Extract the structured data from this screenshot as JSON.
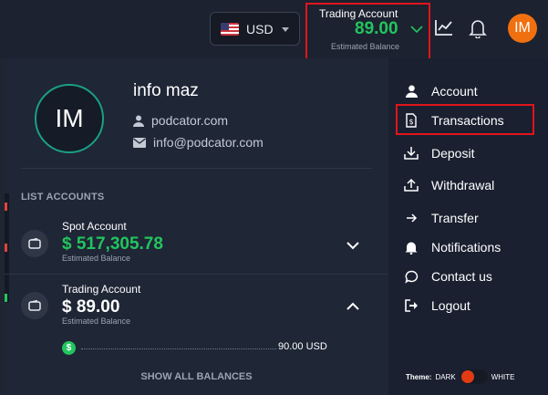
{
  "header": {
    "currency": "USD",
    "account_title": "Trading Account",
    "account_amount": "89.00",
    "account_sub": "Estimated Balance",
    "avatar_initials": "IM"
  },
  "user": {
    "initials": "IM",
    "name": "info maz",
    "username": "podcator.com",
    "email": "info@podcator.com"
  },
  "accounts": {
    "heading": "LIST ACCOUNTS",
    "items": [
      {
        "name": "Spot Account",
        "amount": "$ 517,305.78",
        "sub": "Estimated Balance",
        "expanded": false,
        "amount_color": "#22c55e"
      },
      {
        "name": "Trading Account",
        "amount": "$ 89.00",
        "sub": "Estimated Balance",
        "expanded": true,
        "amount_color": "#ffffff"
      }
    ],
    "balance_symbol": "$",
    "balance_value": "90.00 USD",
    "show_all": "SHOW ALL BALANCES"
  },
  "menu": {
    "items": [
      {
        "label": "Account",
        "icon": "user-icon"
      },
      {
        "label": "Transactions",
        "icon": "receipt-icon"
      },
      {
        "label": "Deposit",
        "icon": "download-icon"
      },
      {
        "label": "Withdrawal",
        "icon": "upload-icon"
      },
      {
        "label": "Transfer",
        "icon": "arrow-right-icon"
      },
      {
        "label": "Notifications",
        "icon": "bell-icon"
      },
      {
        "label": "Contact us",
        "icon": "chat-icon"
      },
      {
        "label": "Logout",
        "icon": "logout-icon"
      }
    ],
    "highlighted": "Transactions"
  },
  "theme": {
    "label": "Theme:",
    "dark": "DARK",
    "white": "WHITE",
    "current": "dark"
  },
  "colors": {
    "accent_green": "#22c55e",
    "highlight_red": "#e2141b",
    "avatar_orange": "#f07010",
    "ring_teal": "#1aa085"
  }
}
